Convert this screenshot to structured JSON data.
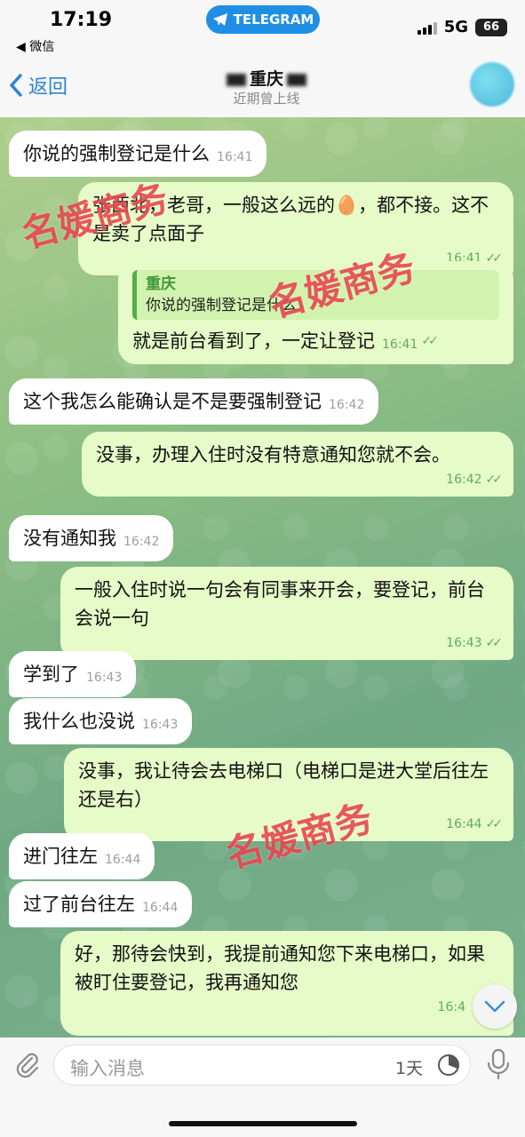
{
  "status_bar": {
    "time": "17:19",
    "back_app": "◀ 微信",
    "telegram_label": "TELEGRAM",
    "network": "5G",
    "battery": "66"
  },
  "header": {
    "back_label": "返回",
    "title": "重庆",
    "subtitle": "近期曾上线"
  },
  "messages": [
    {
      "dir": "in",
      "text": "你说的强制登记是什么",
      "time": "16:41"
    },
    {
      "dir": "out",
      "text": "张西北，老哥，一般这么远的🥚，都不接。这不是卖了点面子",
      "time": "16:41"
    },
    {
      "dir": "out",
      "reply_name": "重庆",
      "reply_text": "你说的强制登记是什么",
      "text": "就是前台看到了，一定让登记",
      "time": "16:41"
    },
    {
      "dir": "in",
      "text": "这个我怎么能确认是不是要强制登记",
      "time": "16:42"
    },
    {
      "dir": "out",
      "text": "没事，办理入住时没有特意通知您就不会。",
      "time": "16:42"
    },
    {
      "dir": "in",
      "text": "没有通知我",
      "time": "16:42"
    },
    {
      "dir": "out",
      "text": "一般入住时说一句会有同事来开会，要登记，前台会说一句",
      "time": "16:43"
    },
    {
      "dir": "in",
      "text": "学到了",
      "time": "16:43"
    },
    {
      "dir": "in",
      "text": "我什么也没说",
      "time": "16:43"
    },
    {
      "dir": "out",
      "text": "没事，我让待会去电梯口（电梯口是进大堂后往左还是右）",
      "time": "16:44"
    },
    {
      "dir": "in",
      "text": "进门往左",
      "time": "16:44"
    },
    {
      "dir": "in",
      "text": "过了前台往左",
      "time": "16:44"
    },
    {
      "dir": "out",
      "text": "好，那待会快到，我提前通知您下来电梯口，如果被盯住要登记，我再通知您",
      "time": "16:4"
    }
  ],
  "watermark": "名媛商务",
  "input": {
    "placeholder": "输入消息",
    "timer_label": "1天"
  },
  "colors": {
    "incoming_bubble": "#ffffff",
    "outgoing_bubble": "#e6fbc8",
    "accent": "#2a83d8",
    "watermark": "#e8474f"
  }
}
